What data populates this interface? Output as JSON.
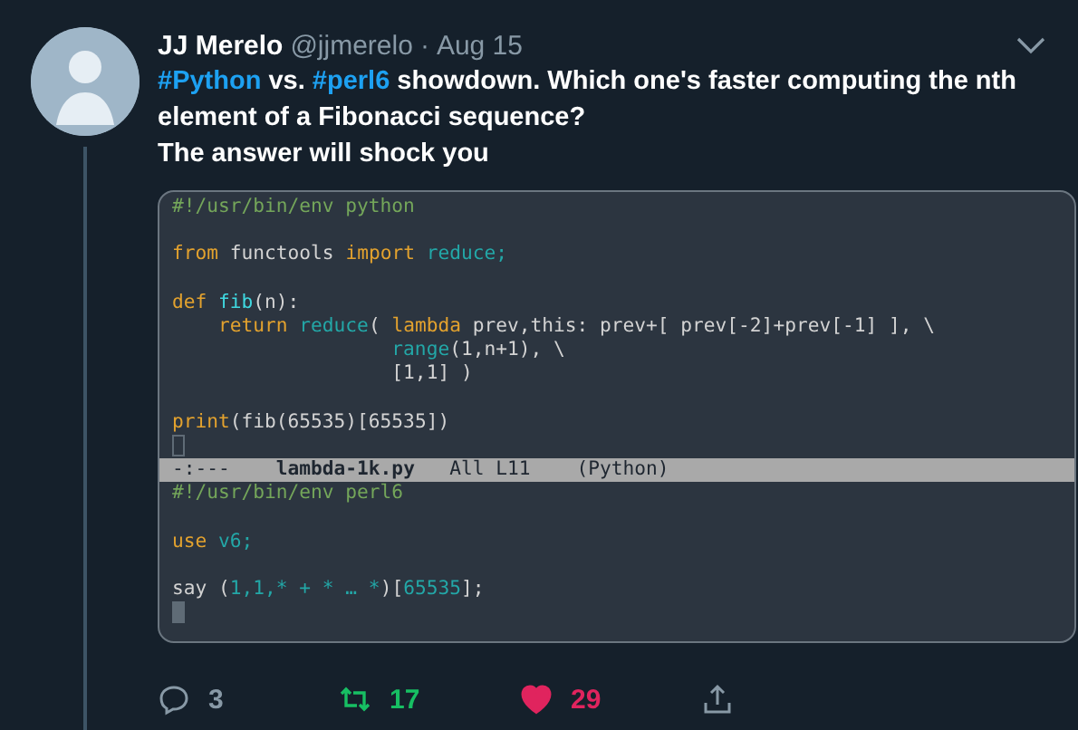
{
  "tweet": {
    "author_name": "JJ Merelo",
    "handle": "@jjmerelo",
    "separator": "·",
    "date": "Aug 15",
    "paragraphs": [
      [
        {
          "kind": "hashtag",
          "text": "#Python"
        },
        {
          "kind": "text",
          "text": " vs. "
        },
        {
          "kind": "hashtag",
          "text": "#perl6"
        },
        {
          "kind": "text",
          "text": " showdown. Which one's faster computing the nth element of a Fibonacci sequence?"
        }
      ],
      [
        {
          "kind": "text",
          "text": "The answer will shock you"
        }
      ]
    ],
    "editor": {
      "buffers": [
        {
          "cursor": {
            "focused": false
          },
          "lines": [
            {
              "space_before": false,
              "tokens": [
                {
                  "kind": "comment",
                  "text": "#!/usr/bin/env python"
                }
              ]
            },
            {
              "space_before": true,
              "tokens": [
                {
                  "kind": "keyword",
                  "text": "from"
                },
                {
                  "kind": "plain",
                  "text": " functools "
                },
                {
                  "kind": "keyword",
                  "text": "import"
                },
                {
                  "kind": "builtin",
                  "text": " reduce;"
                }
              ]
            },
            {
              "space_before": true,
              "tokens": [
                {
                  "kind": "keyword",
                  "text": "def"
                },
                {
                  "kind": "function",
                  "text": " fib"
                },
                {
                  "kind": "plain",
                  "text": "(n):"
                }
              ]
            },
            {
              "space_before": false,
              "tokens": [
                {
                  "kind": "keyword",
                  "text": "    return"
                },
                {
                  "kind": "builtin",
                  "text": " reduce"
                },
                {
                  "kind": "plain",
                  "text": "( "
                },
                {
                  "kind": "keyword",
                  "text": "lambda"
                },
                {
                  "kind": "plain",
                  "text": " prev,this: prev+[ prev[-2]+prev[-1] ], \\"
                }
              ]
            },
            {
              "space_before": false,
              "tokens": [
                {
                  "kind": "builtin",
                  "text": "                   range"
                },
                {
                  "kind": "plain",
                  "text": "(1,n+1), \\"
                }
              ]
            },
            {
              "space_before": false,
              "tokens": [
                {
                  "kind": "plain",
                  "text": "                   [1,1] )"
                }
              ]
            },
            {
              "space_before": true,
              "tokens": [
                {
                  "kind": "keyword",
                  "text": "print"
                },
                {
                  "kind": "plain",
                  "text": "(fib(65535)[65535])"
                }
              ]
            }
          ],
          "mode_line": {
            "status": "-:---",
            "file": "lambda-1k.py",
            "position": "All L11",
            "mode": "(Python)"
          }
        },
        {
          "cursor": {
            "focused": true
          },
          "lines": [
            {
              "space_before": false,
              "tokens": [
                {
                  "kind": "comment",
                  "text": "#!/usr/bin/env perl6"
                }
              ]
            },
            {
              "space_before": true,
              "tokens": [
                {
                  "kind": "keyword",
                  "text": "use"
                },
                {
                  "kind": "builtin",
                  "text": " v6;"
                }
              ]
            },
            {
              "space_before": true,
              "tokens": [
                {
                  "kind": "plain",
                  "text": "say ("
                },
                {
                  "kind": "builtin",
                  "text": "1,1,* + * … *"
                },
                {
                  "kind": "plain",
                  "text": ")["
                },
                {
                  "kind": "builtin",
                  "text": "65535"
                },
                {
                  "kind": "plain",
                  "text": "];"
                }
              ]
            }
          ]
        }
      ]
    },
    "actions": [
      {
        "kind": "reply",
        "count": "3"
      },
      {
        "kind": "retweet",
        "count": "17",
        "on": true
      },
      {
        "kind": "like",
        "count": "29",
        "on": true
      },
      {
        "kind": "share"
      }
    ]
  }
}
